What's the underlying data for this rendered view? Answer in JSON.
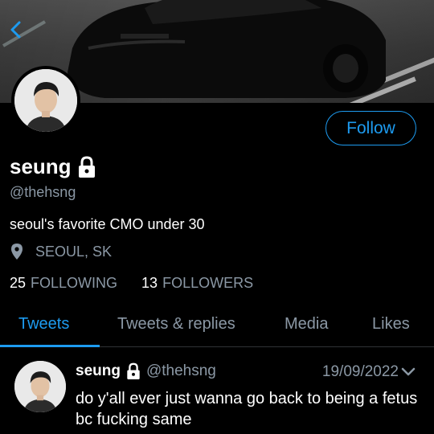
{
  "profile": {
    "display_name": "seung",
    "handle": "@thehsng",
    "bio": "seoul's favorite CMO under 30",
    "location": "SEOUL, SK",
    "following_count": "25",
    "following_label": "FOLLOWING",
    "followers_count": "13",
    "followers_label": "FOLLOWERS",
    "locked": true
  },
  "actions": {
    "follow_label": "Follow"
  },
  "tabs": [
    {
      "label": "Tweets",
      "active": true
    },
    {
      "label": "Tweets & replies",
      "active": false
    },
    {
      "label": "Media",
      "active": false
    },
    {
      "label": "Likes",
      "active": false
    }
  ],
  "tweet": {
    "name": "seung",
    "handle": "@thehsng",
    "date": "19/09/2022",
    "text": "do y'all ever just wanna go back to being a fetus bc fucking same"
  },
  "colors": {
    "accent": "#1d9bf0",
    "background": "#000000",
    "secondary_text": "#8b98a5"
  },
  "icons": {
    "back": "back-arrow-icon",
    "lock": "lock-icon",
    "location": "location-pin-icon",
    "chevron": "chevron-down-icon"
  }
}
